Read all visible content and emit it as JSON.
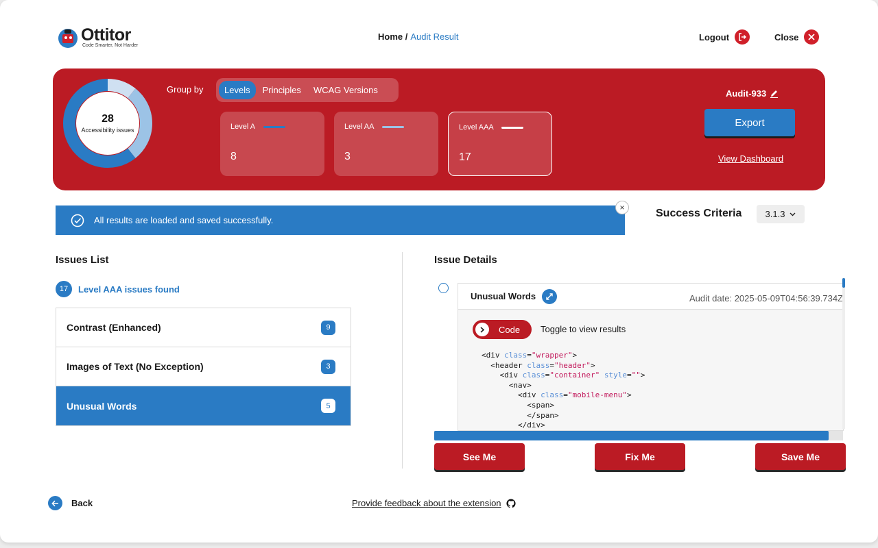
{
  "app": {
    "name": "Ottitor",
    "tagline": "Code Smarter, Not Harder"
  },
  "breadcrumb": {
    "home": "Home /",
    "current": "Audit Result"
  },
  "top_actions": {
    "logout": "Logout",
    "close": "Close"
  },
  "summary": {
    "total_issues": "28",
    "total_label": "Accessibility issues",
    "donut_segments": [
      {
        "level": "Level A",
        "count": 8,
        "color": "#9cc3e6"
      },
      {
        "level": "Level AA",
        "count": 3,
        "color": "#cfe0f2"
      },
      {
        "level": "Level AAA",
        "count": 17,
        "color": "#2a7bc4"
      }
    ]
  },
  "group_by": {
    "label": "Group by",
    "tabs": [
      "Levels",
      "Principles",
      "WCAG Versions"
    ],
    "active": "Levels"
  },
  "levels": [
    {
      "title": "Level A",
      "count": "8",
      "bar_color": "#2a7bc4"
    },
    {
      "title": "Level AA",
      "count": "3",
      "bar_color": "#9cc3e6"
    },
    {
      "title": "Level AAA",
      "count": "17",
      "bar_color": "#ffffff"
    }
  ],
  "audit": {
    "name": "Audit-933",
    "export_label": "Export",
    "view_dashboard": "View Dashboard"
  },
  "alert": {
    "message": "All results are loaded and saved successfully.",
    "close_glyph": "×"
  },
  "success_criteria": {
    "label": "Success Criteria",
    "value": "3.1.3"
  },
  "issues_list": {
    "title": "Issues List",
    "found_count": "17",
    "found_text": "Level AAA issues found",
    "items": [
      {
        "label": "Contrast (Enhanced)",
        "count": "9"
      },
      {
        "label": "Images of Text (No Exception)",
        "count": "3"
      },
      {
        "label": "Unusual Words",
        "count": "5"
      }
    ],
    "active_index": 2
  },
  "issue_details": {
    "title": "Issue Details",
    "card_title": "Unusual Words",
    "audit_date": "Audit date: 2025-05-09T04:56:39.734Z",
    "toggle_label": "Code",
    "toggle_hint": "Toggle to view results",
    "code_lines": [
      {
        "indent": 0,
        "tag": "<div",
        "attr": "class",
        "value": "\"wrapper\"",
        "tail": ">"
      },
      {
        "indent": 1,
        "tag": "<header",
        "attr": "class",
        "value": "\"header\"",
        "tail": ">"
      },
      {
        "indent": 2,
        "tag": "<div",
        "attr": "class",
        "value": "\"container\"",
        "attr2": "style",
        "value2": "\"\"",
        "tail": ">"
      },
      {
        "indent": 3,
        "tag": "<nav>",
        "attr": "",
        "value": "",
        "tail": ""
      },
      {
        "indent": 4,
        "tag": "<div",
        "attr": "class",
        "value": "\"mobile-menu\"",
        "tail": ">"
      },
      {
        "indent": 5,
        "tag": "<span>",
        "attr": "",
        "value": "",
        "tail": ""
      },
      {
        "indent": 5,
        "tag": "</span>",
        "attr": "",
        "value": "",
        "tail": ""
      },
      {
        "indent": 4,
        "tag": "</div>",
        "attr": "",
        "value": "",
        "tail": ""
      }
    ]
  },
  "actions": {
    "see_me": "See Me",
    "fix_me": "Fix Me",
    "save_me": "Save Me"
  },
  "footer": {
    "back": "Back",
    "feedback": "Provide feedback about the extension"
  },
  "colors": {
    "brand_red": "#bb1b24",
    "accent_blue": "#2a7bc4"
  },
  "icons": {
    "logout": "logout-icon",
    "close": "close-icon",
    "edit": "pencil-icon",
    "success": "check-circle-icon",
    "chevron": "chevron-down-icon",
    "expand": "expand-arrows-icon",
    "toggle": "chevron-right-icon",
    "back": "arrow-left-icon",
    "github": "github-icon"
  }
}
